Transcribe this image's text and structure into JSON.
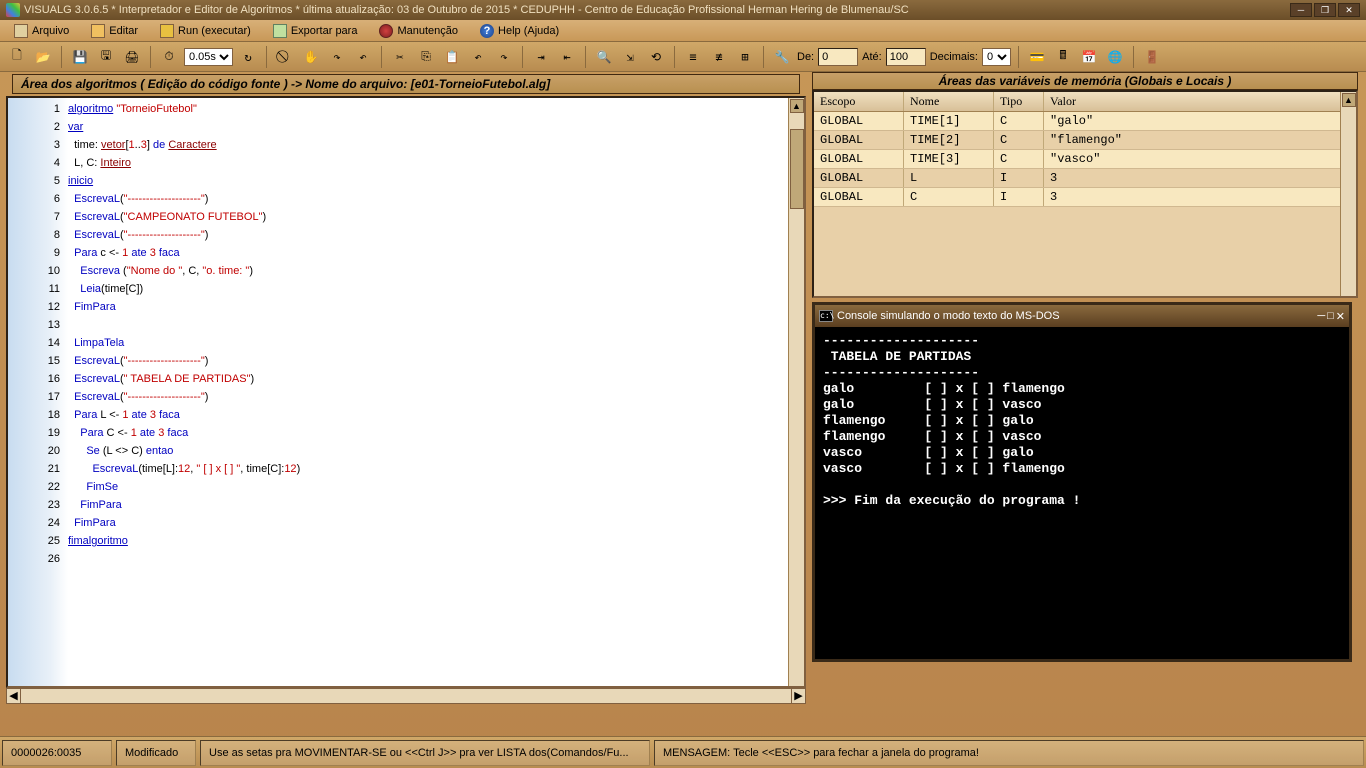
{
  "title": "VISUALG 3.0.6.5 * Interpretador e Editor de Algoritmos * última atualização: 03 de Outubro de 2015 * CEDUPHH - Centro de Educação Profissional Herman Hering de Blumenau/SC",
  "menu": {
    "arquivo": "Arquivo",
    "editar": "Editar",
    "run": "Run (executar)",
    "exportar": "Exportar para",
    "manutencao": "Manutenção",
    "help": "Help (Ajuda)"
  },
  "toolbar": {
    "tempo_val": "0.05s",
    "de_label": "De:",
    "de_val": "0",
    "ate_label": "Até:",
    "ate_val": "100",
    "decimais_label": "Decimais:",
    "decimais_val": "0"
  },
  "editor_header": "Área dos algoritmos ( Edição do código fonte ) -> Nome do arquivo: [e01-TorneioFutebol.alg]",
  "code": [
    {
      "n": 1,
      "html": "<span class='kw'>algoritmo</span> <span class='str'>\"TorneioFutebol\"</span>"
    },
    {
      "n": 2,
      "html": "<span class='kw'>var</span>"
    },
    {
      "n": 3,
      "html": "  time: <span class='typ'>vetor</span>[<span class='num'>1</span>..<span class='num'>3</span>] <span class='kwnu'>de</span> <span class='typ'>Caractere</span>"
    },
    {
      "n": 4,
      "html": "  L, C: <span class='typ'>Inteiro</span>"
    },
    {
      "n": 5,
      "html": "<span class='kw'>inicio</span>"
    },
    {
      "n": 6,
      "html": "  <span class='kwnu'>EscrevaL</span>(<span class='str'>\"--------------------\"</span>)"
    },
    {
      "n": 7,
      "html": "  <span class='kwnu'>EscrevaL</span>(<span class='str'>\"CAMPEONATO FUTEBOL\"</span>)"
    },
    {
      "n": 8,
      "html": "  <span class='kwnu'>EscrevaL</span>(<span class='str'>\"--------------------\"</span>)"
    },
    {
      "n": 9,
      "html": "  <span class='kwnu'>Para</span> c <- <span class='num'>1</span> <span class='kwnu'>ate</span> <span class='num'>3</span> <span class='kwnu'>faca</span>"
    },
    {
      "n": 10,
      "html": "    <span class='kwnu'>Escreva</span> (<span class='str'>\"Nome do \"</span>, C, <span class='str'>\"o. time: \"</span>)"
    },
    {
      "n": 11,
      "html": "    <span class='kwnu'>Leia</span>(time[C])"
    },
    {
      "n": 12,
      "html": "  <span class='kwnu'>FimPara</span>"
    },
    {
      "n": 13,
      "html": ""
    },
    {
      "n": 14,
      "html": "  <span class='kwnu'>LimpaTela</span>"
    },
    {
      "n": 15,
      "html": "  <span class='kwnu'>EscrevaL</span>(<span class='str'>\"--------------------\"</span>)"
    },
    {
      "n": 16,
      "html": "  <span class='kwnu'>EscrevaL</span>(<span class='str'>\" TABELA DE PARTIDAS\"</span>)"
    },
    {
      "n": 17,
      "html": "  <span class='kwnu'>EscrevaL</span>(<span class='str'>\"--------------------\"</span>)"
    },
    {
      "n": 18,
      "html": "  <span class='kwnu'>Para</span> L <- <span class='num'>1</span> <span class='kwnu'>ate</span> <span class='num'>3</span> <span class='kwnu'>faca</span>"
    },
    {
      "n": 19,
      "html": "    <span class='kwnu'>Para</span> C <- <span class='num'>1</span> <span class='kwnu'>ate</span> <span class='num'>3</span> <span class='kwnu'>faca</span>"
    },
    {
      "n": 20,
      "html": "      <span class='kwnu'>Se</span> (L &lt;&gt; C) <span class='kwnu'>entao</span>"
    },
    {
      "n": 21,
      "html": "        <span class='kwnu'>EscrevaL</span>(time[L]:<span class='num'>12</span>, <span class='str'>\" [ ] x [ ] \"</span>, time[C]:<span class='num'>12</span>)"
    },
    {
      "n": 22,
      "html": "      <span class='kwnu'>FimSe</span>"
    },
    {
      "n": 23,
      "html": "    <span class='kwnu'>FimPara</span>"
    },
    {
      "n": 24,
      "html": "  <span class='kwnu'>FimPara</span>"
    },
    {
      "n": 25,
      "html": "<span class='kw'>fimalgoritmo</span>"
    },
    {
      "n": 26,
      "html": ""
    }
  ],
  "vars_header": "Áreas das variáveis de memória (Globais e Locais )",
  "vars_cols": {
    "escopo": "Escopo",
    "nome": "Nome",
    "tipo": "Tipo",
    "valor": "Valor"
  },
  "vars": [
    {
      "escopo": "GLOBAL",
      "nome": "TIME[1]",
      "tipo": "C",
      "valor": "\"galo\"",
      "sel": true
    },
    {
      "escopo": "GLOBAL",
      "nome": "TIME[2]",
      "tipo": "C",
      "valor": "\"flamengo\""
    },
    {
      "escopo": "GLOBAL",
      "nome": "TIME[3]",
      "tipo": "C",
      "valor": "\"vasco\"",
      "sel": true
    },
    {
      "escopo": "GLOBAL",
      "nome": "L",
      "tipo": "I",
      "valor": "3"
    },
    {
      "escopo": "GLOBAL",
      "nome": "C",
      "tipo": "I",
      "valor": "3",
      "sel": true
    }
  ],
  "console_title": "Console simulando o modo texto do MS-DOS",
  "console_lines": [
    "--------------------",
    " TABELA DE PARTIDAS",
    "--------------------",
    "galo         [ ] x [ ] flamengo",
    "galo         [ ] x [ ] vasco",
    "flamengo     [ ] x [ ] galo",
    "flamengo     [ ] x [ ] vasco",
    "vasco        [ ] x [ ] galo",
    "vasco        [ ] x [ ] flamengo",
    "",
    ">>> Fim da execução do programa !"
  ],
  "status": {
    "pos": "0000026:0035",
    "state": "Modificado",
    "hint": "Use as setas pra MOVIMENTAR-SE ou <<Ctrl J>> pra ver LISTA dos(Comandos/Fu...",
    "msg": "MENSAGEM: Tecle <<ESC>>  para fechar a janela do programa!"
  }
}
